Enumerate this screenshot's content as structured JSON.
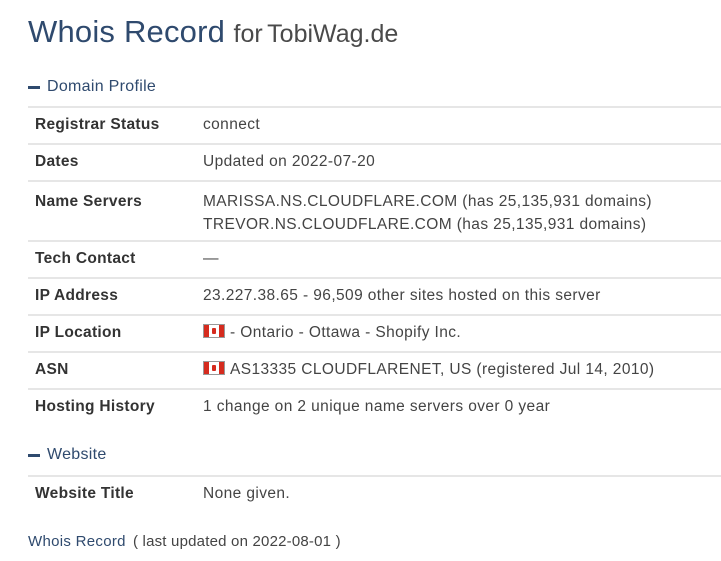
{
  "header": {
    "title_main": "Whois Record",
    "title_for": "for",
    "domain": "TobiWag.de"
  },
  "domain_profile": {
    "heading": "Domain Profile",
    "rows": [
      {
        "label": "Registrar Status",
        "value": "connect"
      },
      {
        "label": "Dates",
        "value": "Updated on 2022-07-20"
      },
      {
        "label": "Name Servers",
        "lines": [
          "MARISSA.NS.CLOUDFLARE.COM (has 25,135,931 domains)",
          "TREVOR.NS.CLOUDFLARE.COM (has 25,135,931 domains)"
        ]
      },
      {
        "label": "Tech Contact",
        "value": "—"
      },
      {
        "label": "IP Address",
        "value": "23.227.38.65 - 96,509 other sites hosted on this server"
      },
      {
        "label": "IP Location",
        "value": "- Ontario - Ottawa - Shopify Inc.",
        "flag_icon": "canada-flag-icon"
      },
      {
        "label": "ASN",
        "value": "AS13335 CLOUDFLARENET, US (registered Jul 14, 2010)",
        "flag_icon": "canada-flag-icon"
      },
      {
        "label": "Hosting History",
        "value": "1 change on 2 unique name servers over 0 year"
      }
    ]
  },
  "website": {
    "heading": "Website",
    "rows": [
      {
        "label": "Website Title",
        "value": "None given."
      }
    ]
  },
  "footer": {
    "link": "Whois Record",
    "note": "( last updated on 2022-08-01 )"
  },
  "colors": {
    "accent": "#2f4a6e",
    "border": "#e6e6e6",
    "text": "#444444"
  }
}
